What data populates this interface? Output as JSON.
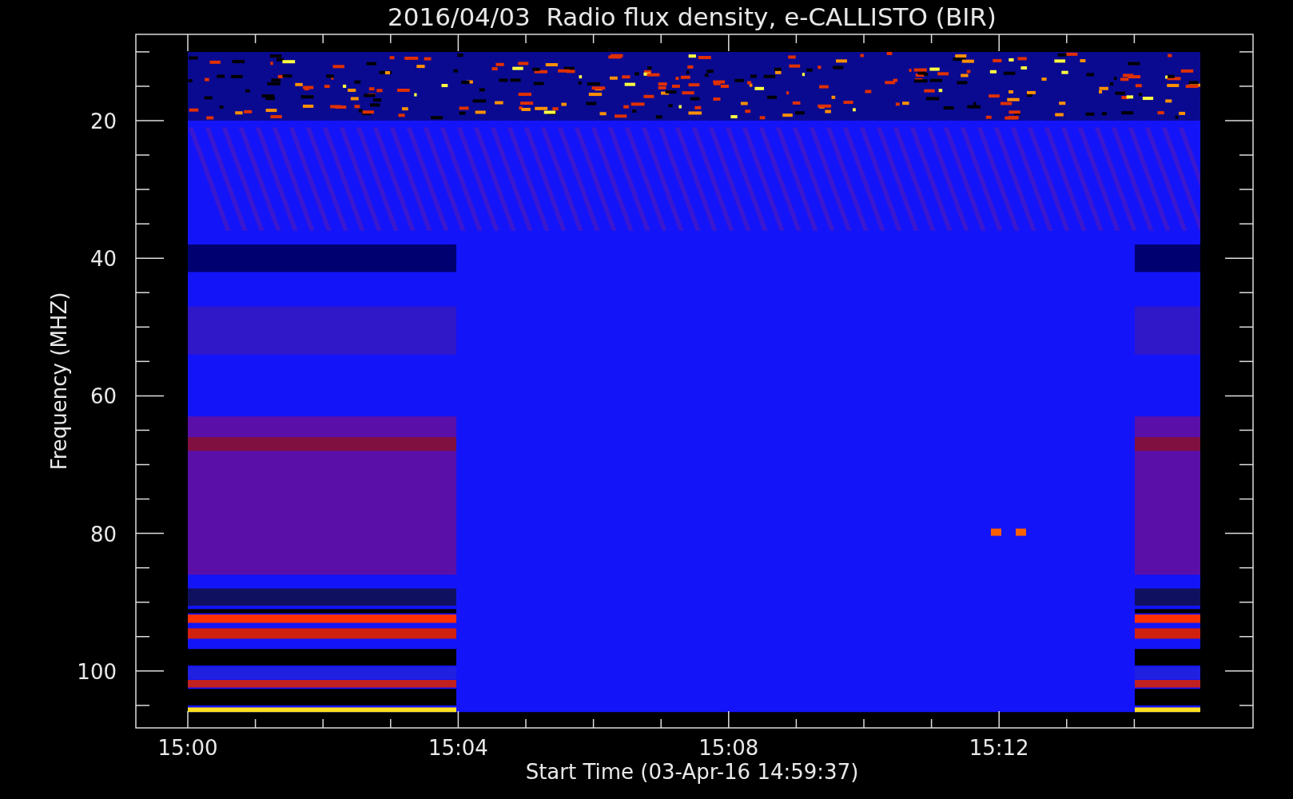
{
  "title": "2016/04/03  Radio flux density, e-CALLISTO (BIR)",
  "xlabel": "Start Time (03-Apr-16 14:59:37)",
  "ylabel": "Frequency (MHZ)",
  "xticks": [
    "15:00",
    "15:04",
    "15:08",
    "15:12"
  ],
  "yticks": [
    "20",
    "40",
    "60",
    "80",
    "100"
  ]
}
